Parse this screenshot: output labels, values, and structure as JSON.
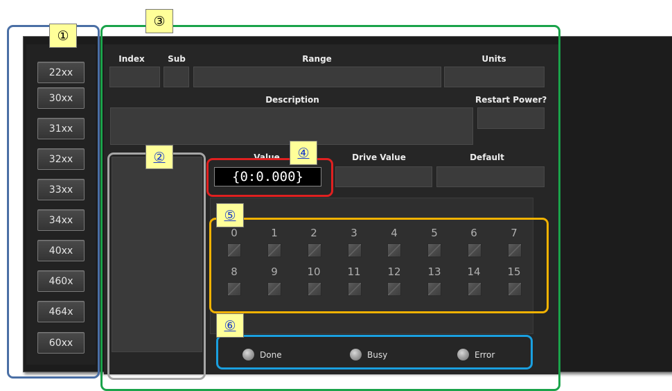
{
  "groups": [
    "22xx",
    "30xx",
    "31xx",
    "32xx",
    "33xx",
    "34xx",
    "40xx",
    "460x",
    "464x",
    "60xx"
  ],
  "labels": {
    "index": "Index",
    "sub": "Sub",
    "range": "Range",
    "units": "Units",
    "description": "Description",
    "restart_power": "Restart Power?",
    "value": "Value",
    "drive_value": "Drive Value",
    "default": "Default"
  },
  "value_display": "{0:0.000}",
  "bits": [
    "0",
    "1",
    "2",
    "3",
    "4",
    "5",
    "6",
    "7",
    "8",
    "9",
    "10",
    "11",
    "12",
    "13",
    "14",
    "15"
  ],
  "status": {
    "done": "Done",
    "busy": "Busy",
    "error": "Error"
  },
  "callouts": [
    "①",
    "②",
    "③",
    "④",
    "⑤",
    "⑥"
  ],
  "colors": {
    "frame_groups": "#4a6fa5",
    "frame_list": "#a6a6a6",
    "frame_main": "#1aa34a",
    "frame_value": "#e02020",
    "frame_bits": "#f2b200",
    "frame_status": "#1aa0e0",
    "badge_bg": "#ffff99"
  }
}
